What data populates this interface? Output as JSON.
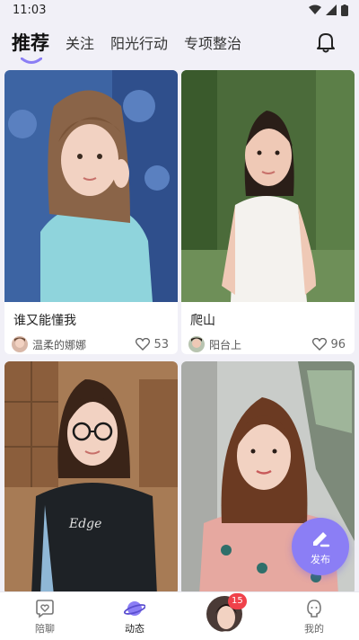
{
  "status_bar": {
    "time": "11:03"
  },
  "header": {
    "tabs": [
      {
        "label": "推荐",
        "active": true
      },
      {
        "label": "关注",
        "active": false
      },
      {
        "label": "阳光行动",
        "active": false
      },
      {
        "label": "专项整治",
        "active": false
      }
    ],
    "bell_icon": "bell-icon"
  },
  "feed": {
    "cards": [
      {
        "title": "谁又能懂我",
        "author": "温柔的娜娜",
        "likes": "53"
      },
      {
        "title": "爬山",
        "author": "阳台上",
        "likes": "96"
      },
      {
        "title": "",
        "author": "",
        "likes": ""
      },
      {
        "title": "",
        "author": "",
        "likes": ""
      }
    ]
  },
  "fab": {
    "label": "发布",
    "icon": "edit-icon"
  },
  "bottom_nav": {
    "items": [
      {
        "label": "陪聊",
        "icon": "heart-chat-icon"
      },
      {
        "label": "动态",
        "icon": "planet-icon"
      },
      {
        "label": "",
        "icon": "avatar"
      },
      {
        "label": "我的",
        "icon": "profile-icon"
      }
    ],
    "badge": "15"
  },
  "colors": {
    "accent": "#8b7ef5",
    "badge": "#f0414a",
    "background": "#f1f0f7"
  }
}
